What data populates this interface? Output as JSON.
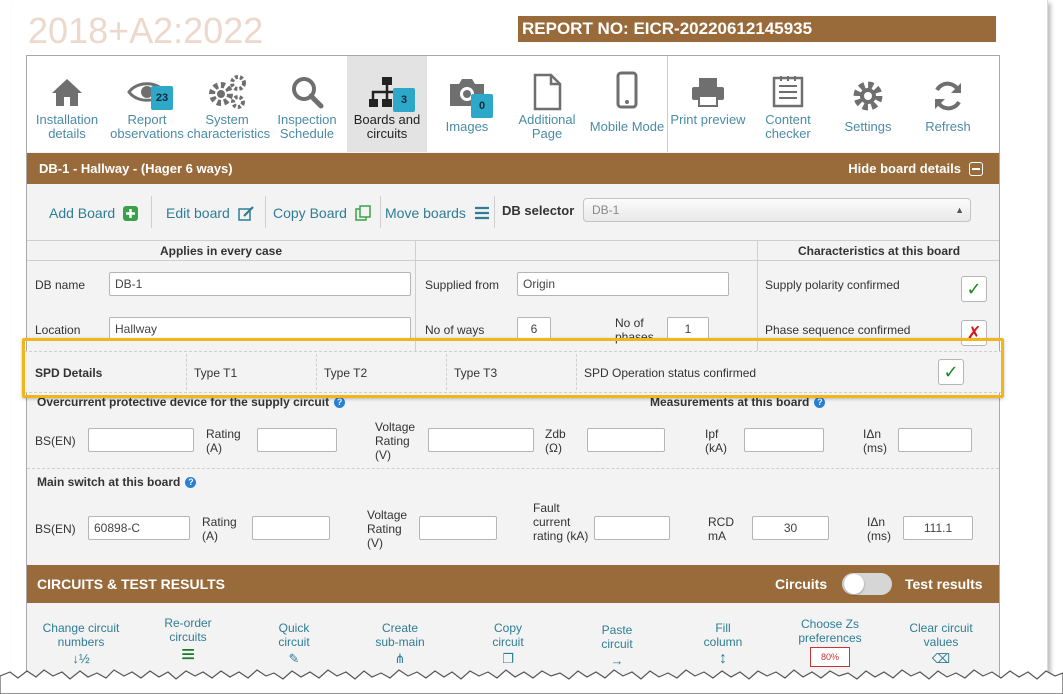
{
  "header": {
    "logo_text": "2018+A2:2022",
    "report_no": "REPORT NO: EICR-20220612145935"
  },
  "toolbar": {
    "items": [
      {
        "label": "Installation details",
        "icon": "home-icon"
      },
      {
        "label": "Report observations",
        "icon": "eye-icon",
        "badge": "23"
      },
      {
        "label": "System characteristics",
        "icon": "gears-icon"
      },
      {
        "label": "Inspection Schedule",
        "icon": "search-icon"
      },
      {
        "label": "Boards and circuits",
        "icon": "sitemap-icon",
        "badge": "3",
        "active": true
      },
      {
        "label": "Images",
        "icon": "camera-icon",
        "badge": "0"
      },
      {
        "label": "Additional Page",
        "icon": "document-icon"
      },
      {
        "label": "Mobile Mode",
        "icon": "mobile-icon"
      },
      {
        "label": "Print preview",
        "icon": "printer-icon"
      },
      {
        "label": "Content checker",
        "icon": "checklist-icon"
      },
      {
        "label": "Settings",
        "icon": "gear-icon"
      },
      {
        "label": "Refresh",
        "icon": "refresh-icon"
      }
    ]
  },
  "board": {
    "title": "DB-1 - Hallway - (Hager 6 ways)",
    "hide_label": "Hide board details"
  },
  "actions": {
    "add_board": "Add Board",
    "edit_board": "Edit board",
    "copy_board": "Copy Board",
    "move_boards": "Move boards",
    "db_selector_label": "DB selector",
    "db_selector_value": "DB-1"
  },
  "columns": {
    "applies": "Applies in every case",
    "characteristics": "Characteristics at this board"
  },
  "fields": {
    "db_name_label": "DB name",
    "db_name_value": "DB-1",
    "location_label": "Location",
    "location_value": "Hallway",
    "supplied_from_label": "Supplied from",
    "supplied_from_value": "Origin",
    "no_of_ways_label": "No of ways",
    "no_of_ways_value": "6",
    "no_of_phases_label": "No of phases",
    "no_of_phases_value": "1",
    "supply_polarity_label": "Supply polarity confirmed",
    "phase_sequence_label": "Phase sequence confirmed"
  },
  "spd": {
    "title": "SPD Details",
    "t1": "Type T1",
    "t2": "Type T2",
    "t3": "Type T3",
    "status": "SPD Operation status confirmed"
  },
  "ocpd": {
    "title": "Overcurrent protective device for the supply circuit",
    "measurements_title": "Measurements at this board",
    "bsen": "BS(EN)",
    "rating": "Rating (A)",
    "voltage": "Voltage Rating (V)",
    "zdb": "Zdb (Ω)",
    "ipf": "Ipf (kA)",
    "idn": "IΔn (ms)"
  },
  "main_switch": {
    "title": "Main switch at this board",
    "bsen": "BS(EN)",
    "bsen_value": "60898-C",
    "rating": "Rating (A)",
    "voltage": "Voltage Rating (V)",
    "fault": "Fault current rating (kA)",
    "rcd": "RCD mA",
    "rcd_value": "30",
    "idn": "IΔn (ms)",
    "idn_value": "111.1"
  },
  "circuits": {
    "title": "CIRCUITS & TEST RESULTS",
    "left": "Circuits",
    "right": "Test results",
    "buttons": [
      {
        "label": "Change circuit numbers",
        "glyph": "↓½"
      },
      {
        "label": "Re-order circuits",
        "glyph": "≡"
      },
      {
        "label": "Quick circuit",
        "glyph": "✎"
      },
      {
        "label": "Create sub-main",
        "glyph": "⋔"
      },
      {
        "label": "Copy circuit",
        "glyph": "❐"
      },
      {
        "label": "Paste circuit",
        "glyph": "→"
      },
      {
        "label": "Fill column",
        "glyph": "↕"
      },
      {
        "label": "Choose Zs preferences",
        "glyph": "80%"
      },
      {
        "label": "Clear circuit values",
        "glyph": "⌫"
      }
    ]
  }
}
